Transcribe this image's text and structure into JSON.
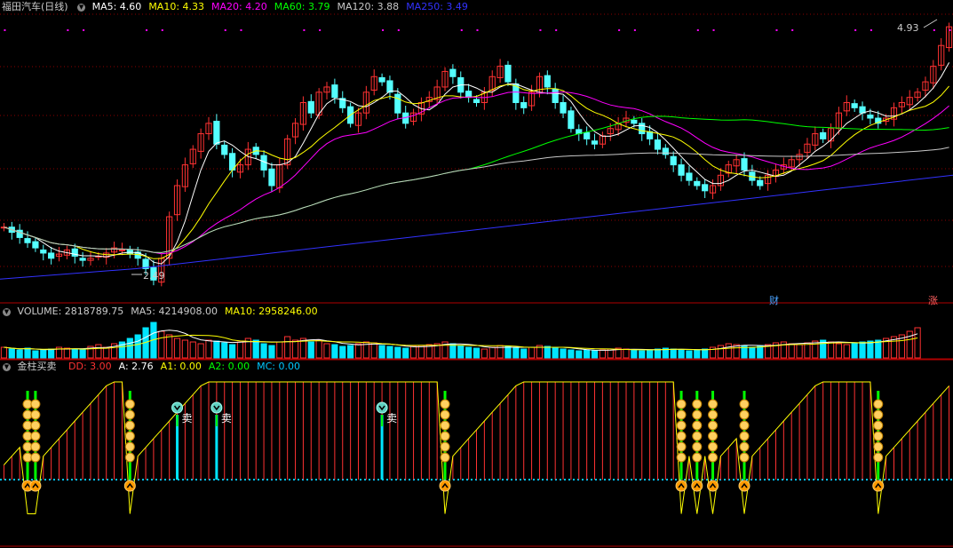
{
  "colors": {
    "bg": "#000000",
    "up": "#ff3232",
    "down": "#54ffff",
    "grid": "#8b0000",
    "ma5": "#ffffff",
    "ma10": "#ffff00",
    "ma20": "#ff00ff",
    "ma60": "#00ff00",
    "ma120": "#c8c8c8",
    "ma250": "#3232ff",
    "vol_ma5": "#ffffff",
    "vol_ma10": "#ffff00",
    "bar_red": "#ff3232",
    "bar_cyan": "#00e5ff",
    "curve": "#ffff00",
    "dd": "#ff3232",
    "a": "#ffffff",
    "a1": "#ffff00",
    "a2": "#00ff00",
    "mc": "#00c8ff"
  },
  "main": {
    "stock_name": "福田汽车(日线)",
    "indicators": [
      {
        "label": "MA5: 4.60",
        "color": "#ffffff"
      },
      {
        "label": "MA10: 4.33",
        "color": "#ffff00"
      },
      {
        "label": "MA20: 4.20",
        "color": "#ff00ff"
      },
      {
        "label": "MA60: 3.79",
        "color": "#00ff00"
      },
      {
        "label": "MA120: 3.88",
        "color": "#c8c8c8"
      },
      {
        "label": "MA250: 3.49",
        "color": "#3232ff"
      }
    ],
    "high_label": "4.93",
    "low_label": "2.49",
    "badge_cai": "财",
    "badge_zhang": "涨"
  },
  "volume": {
    "indicators": [
      {
        "label": "VOLUME: 2818789.75",
        "color": "#cccccc"
      },
      {
        "label": "MA5: 4214908.00",
        "color": "#cccccc"
      },
      {
        "label": "MA10: 2958246.00",
        "color": "#ffff00"
      }
    ]
  },
  "jinzhu": {
    "name": "金柱买卖",
    "indicators": [
      {
        "label": "DD: 3.00",
        "color": "#ff3232"
      },
      {
        "label": "A: 2.76",
        "color": "#ffffff"
      },
      {
        "label": "A1: 0.00",
        "color": "#ffff00"
      },
      {
        "label": "A2: 0.00",
        "color": "#00ff00"
      },
      {
        "label": "MC: 0.00",
        "color": "#00c8ff"
      }
    ],
    "sell_label": "卖",
    "buy_signals": [
      3,
      4,
      16,
      56,
      86,
      88,
      90,
      94,
      111
    ],
    "sell_signals": [
      22,
      27,
      48
    ]
  },
  "chart_data": {
    "type": "candlestick",
    "price_range": [
      2.45,
      5.0
    ],
    "closes": [
      3.0,
      2.95,
      2.9,
      2.85,
      2.8,
      2.75,
      2.7,
      2.74,
      2.78,
      2.72,
      2.68,
      2.7,
      2.72,
      2.75,
      2.8,
      2.78,
      2.74,
      2.7,
      2.6,
      2.49,
      2.7,
      3.1,
      3.4,
      3.6,
      3.75,
      3.9,
      4.0,
      3.8,
      3.7,
      3.55,
      3.6,
      3.75,
      3.7,
      3.55,
      3.4,
      3.6,
      3.85,
      4.0,
      4.2,
      4.1,
      4.3,
      4.35,
      4.25,
      4.15,
      4.0,
      4.1,
      4.3,
      4.45,
      4.4,
      4.3,
      4.1,
      4.0,
      4.1,
      4.2,
      4.25,
      4.35,
      4.5,
      4.45,
      4.3,
      4.25,
      4.2,
      4.3,
      4.45,
      4.55,
      4.4,
      4.2,
      4.15,
      4.3,
      4.45,
      4.35,
      4.2,
      4.1,
      3.95,
      3.9,
      3.85,
      3.8,
      3.88,
      3.95,
      4.0,
      4.05,
      4.0,
      3.9,
      3.85,
      3.75,
      3.7,
      3.6,
      3.5,
      3.45,
      3.4,
      3.35,
      3.4,
      3.5,
      3.6,
      3.65,
      3.55,
      3.45,
      3.4,
      3.5,
      3.55,
      3.6,
      3.65,
      3.7,
      3.8,
      3.9,
      3.85,
      3.95,
      4.1,
      4.2,
      4.15,
      4.1,
      4.05,
      4.0,
      4.05,
      4.15,
      4.2,
      4.25,
      4.3,
      4.4,
      4.55,
      4.75,
      4.93
    ],
    "ma250": [
      2.5,
      2.6,
      2.75,
      2.9,
      3.05,
      3.2,
      3.35,
      3.5
    ],
    "volume": [
      1.2,
      1.0,
      0.9,
      1.1,
      0.8,
      0.9,
      1.0,
      1.2,
      1.1,
      1.0,
      0.9,
      1.3,
      1.5,
      1.2,
      1.6,
      1.8,
      2.2,
      2.6,
      3.4,
      4.0,
      3.0,
      2.6,
      2.2,
      2.0,
      1.8,
      1.6,
      2.0,
      1.9,
      1.7,
      1.5,
      1.8,
      2.2,
      2.0,
      1.6,
      1.4,
      1.8,
      2.4,
      2.0,
      2.2,
      1.8,
      2.0,
      1.6,
      1.5,
      1.3,
      1.4,
      1.6,
      1.8,
      1.7,
      1.4,
      1.3,
      1.2,
      1.1,
      1.3,
      1.4,
      1.5,
      1.6,
      1.8,
      1.6,
      1.4,
      1.2,
      1.1,
      1.0,
      1.2,
      1.4,
      1.3,
      1.1,
      1.0,
      1.2,
      1.4,
      1.3,
      1.1,
      1.0,
      0.9,
      0.8,
      0.9,
      0.8,
      0.9,
      1.0,
      1.1,
      1.0,
      0.9,
      0.8,
      0.9,
      1.0,
      1.1,
      1.0,
      0.9,
      0.8,
      0.9,
      1.0,
      1.2,
      1.4,
      1.6,
      1.5,
      1.4,
      1.2,
      1.3,
      1.5,
      1.7,
      1.8,
      1.6,
      1.5,
      1.7,
      1.9,
      2.0,
      1.8,
      1.6,
      1.5,
      1.7,
      1.8,
      1.9,
      2.0,
      2.2,
      2.4,
      2.6,
      3.0,
      3.4
    ]
  }
}
